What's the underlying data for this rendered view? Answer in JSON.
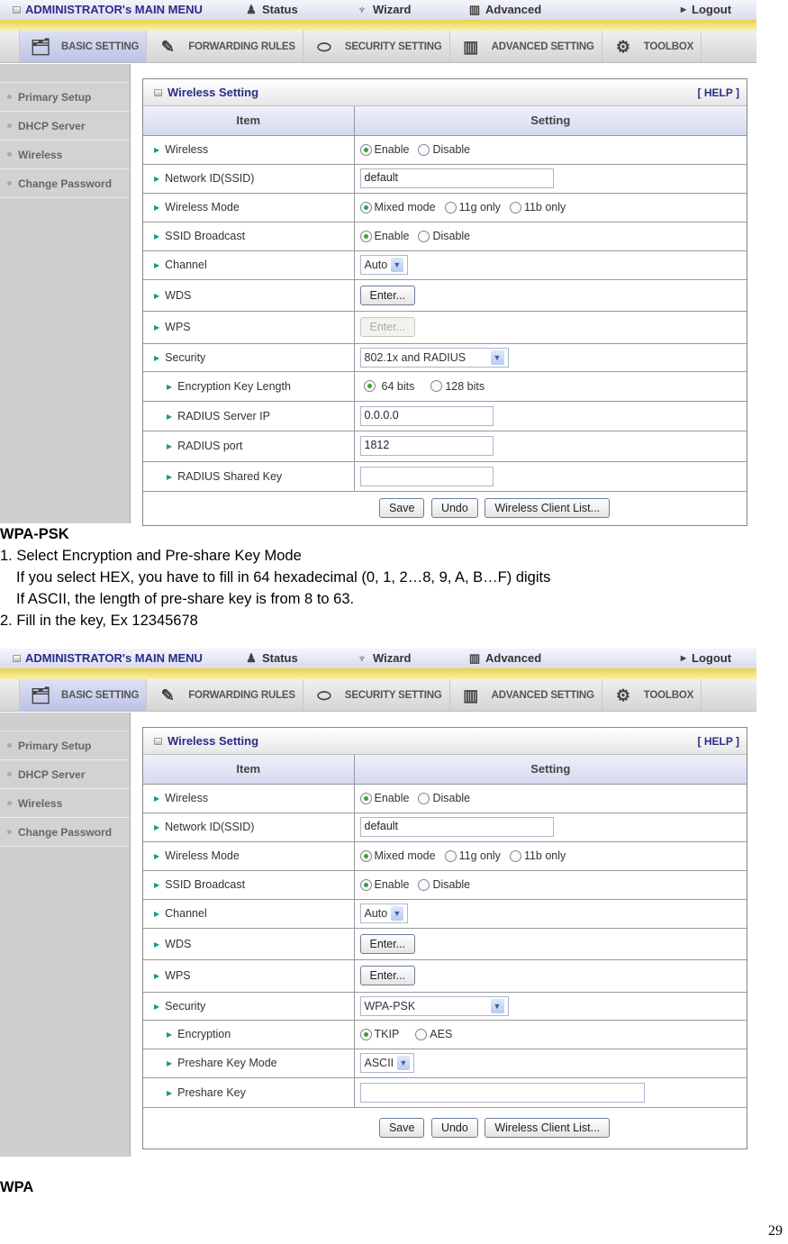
{
  "header": {
    "title": "ADMINISTRATOR's MAIN MENU",
    "status": "Status",
    "wizard": "Wizard",
    "advanced": "Advanced",
    "logout": "Logout"
  },
  "nav_tabs": [
    {
      "label": "BASIC SETTING",
      "icon": "folder-doc-icon"
    },
    {
      "label": "FORWARDING RULES",
      "icon": "forward-icon"
    },
    {
      "label": "SECURITY SETTING",
      "icon": "lock-icon"
    },
    {
      "label": "ADVANCED SETTING",
      "icon": "advanced-icon"
    },
    {
      "label": "TOOLBOX",
      "icon": "toolbox-icon"
    }
  ],
  "sidebar": {
    "items": [
      {
        "label": "Primary Setup"
      },
      {
        "label": "DHCP Server"
      },
      {
        "label": "Wireless"
      },
      {
        "label": "Change Password"
      }
    ]
  },
  "panel": {
    "title": "Wireless Setting",
    "help": "[ HELP ]",
    "col_item": "Item",
    "col_setting": "Setting"
  },
  "rows": {
    "wireless": {
      "label": "Wireless",
      "opt1": "Enable",
      "opt2": "Disable"
    },
    "ssid": {
      "label": "Network ID(SSID)",
      "value": "default"
    },
    "mode": {
      "label": "Wireless Mode",
      "opt1": "Mixed mode",
      "opt2": "11g only",
      "opt3": "11b only"
    },
    "broadcast": {
      "label": "SSID Broadcast",
      "opt1": "Enable",
      "opt2": "Disable"
    },
    "channel": {
      "label": "Channel",
      "value": "Auto"
    },
    "wds": {
      "label": "WDS",
      "button": "Enter..."
    },
    "wps": {
      "label": "WPS",
      "button": "Enter..."
    },
    "security": {
      "label": "Security"
    }
  },
  "shot1": {
    "security_value": "802.1x and RADIUS",
    "keylen": {
      "label": "Encryption Key Length",
      "opt1": "64 bits",
      "opt2": "128 bits"
    },
    "radius_ip": {
      "label": "RADIUS Server IP",
      "value": "0.0.0.0"
    },
    "radius_port": {
      "label": "RADIUS port",
      "value": "1812"
    },
    "radius_key": {
      "label": "RADIUS Shared Key",
      "value": ""
    }
  },
  "shot2": {
    "security_value": "WPA-PSK",
    "encryption": {
      "label": "Encryption",
      "opt1": "TKIP",
      "opt2": "AES"
    },
    "psk_mode": {
      "label": "Preshare Key Mode",
      "value": "ASCII"
    },
    "psk": {
      "label": "Preshare Key",
      "value": ""
    }
  },
  "buttons": {
    "save": "Save",
    "undo": "Undo",
    "client_list": "Wireless Client List..."
  },
  "doc": {
    "heading1": "WPA-PSK",
    "line1": "1. Select Encryption and Pre-share Key Mode",
    "line2": "If you select HEX, you have to fill in 64 hexadecimal (0, 1, 2…8, 9, A, B…F) digits",
    "line3": "If ASCII, the length of pre-share key is from 8 to 63.",
    "line4": "2. Fill in the key, Ex 12345678",
    "heading2": "WPA",
    "page_number": "29"
  }
}
